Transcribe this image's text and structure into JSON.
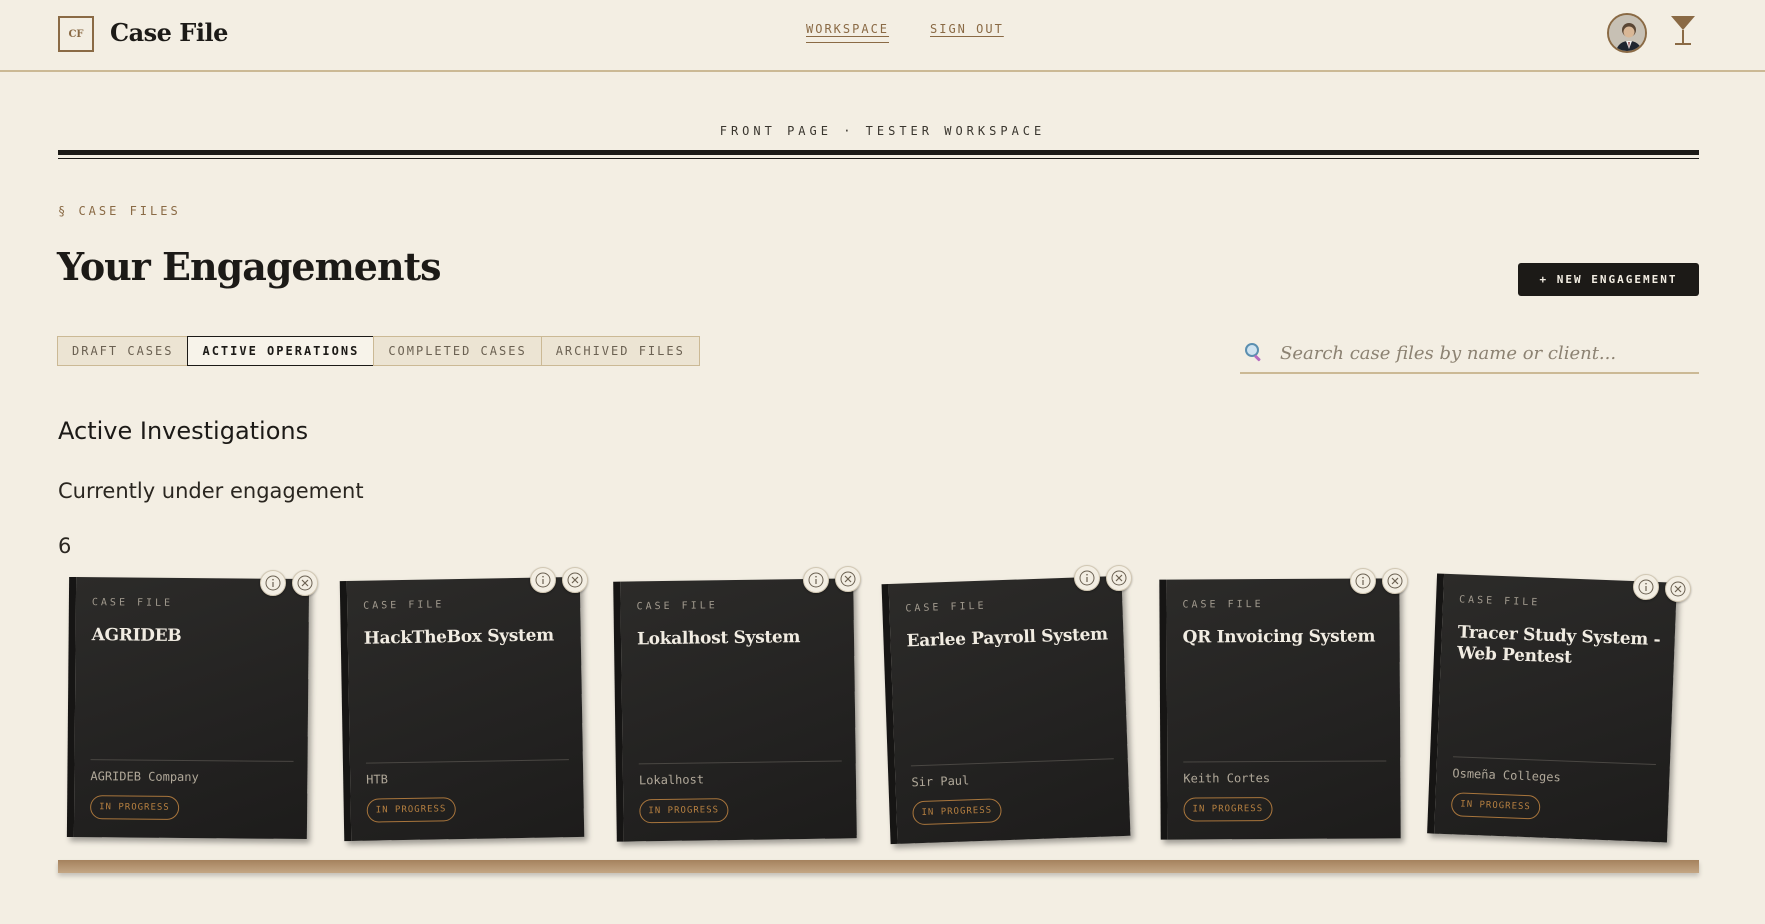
{
  "brand": {
    "logo_mark": "CF",
    "name": "Case File"
  },
  "nav": {
    "workspace": "WORKSPACE",
    "sign_out": "SIGN OUT"
  },
  "masthead": {
    "label": "FRONT PAGE · TESTER WORKSPACE"
  },
  "section_mark": "§ CASE FILES",
  "page_title": "Your Engagements",
  "new_button": "+ NEW ENGAGEMENT",
  "tabs": [
    {
      "label": "DRAFT CASES",
      "active": false
    },
    {
      "label": "ACTIVE OPERATIONS",
      "active": true
    },
    {
      "label": "COMPLETED CASES",
      "active": false
    },
    {
      "label": "ARCHIVED FILES",
      "active": false
    }
  ],
  "search": {
    "placeholder": "Search case files by name or client..."
  },
  "section": {
    "heading": "Active Investigations",
    "subheading": "Currently under engagement",
    "count": "6"
  },
  "cards": [
    {
      "kicker": "CASE FILE",
      "title": "AGRIDEB",
      "client": "AGRIDEB Company",
      "status": "IN PROGRESS"
    },
    {
      "kicker": "CASE FILE",
      "title": "HackTheBox System",
      "client": "HTB",
      "status": "IN PROGRESS"
    },
    {
      "kicker": "CASE FILE",
      "title": "Lokalhost System",
      "client": "Lokalhost",
      "status": "IN PROGRESS"
    },
    {
      "kicker": "CASE FILE",
      "title": "Earlee Payroll System",
      "client": "Sir Paul",
      "status": "IN PROGRESS"
    },
    {
      "kicker": "CASE FILE",
      "title": "QR Invoicing System",
      "client": "Keith Cortes",
      "status": "IN PROGRESS"
    },
    {
      "kicker": "CASE FILE",
      "title": "Tracer Study System - Web Pentest",
      "client": "Osmeña Colleges",
      "status": "IN PROGRESS"
    }
  ],
  "colors": {
    "paper": "#f3eee3",
    "ink": "#1c1a17",
    "accent": "#8a6a45",
    "card": "#262524",
    "status": "#b57f40"
  },
  "icons": {
    "search": "search-icon",
    "info": "info-icon",
    "close": "close-circle-icon",
    "logo_right": "cocktail-glass-icon"
  }
}
